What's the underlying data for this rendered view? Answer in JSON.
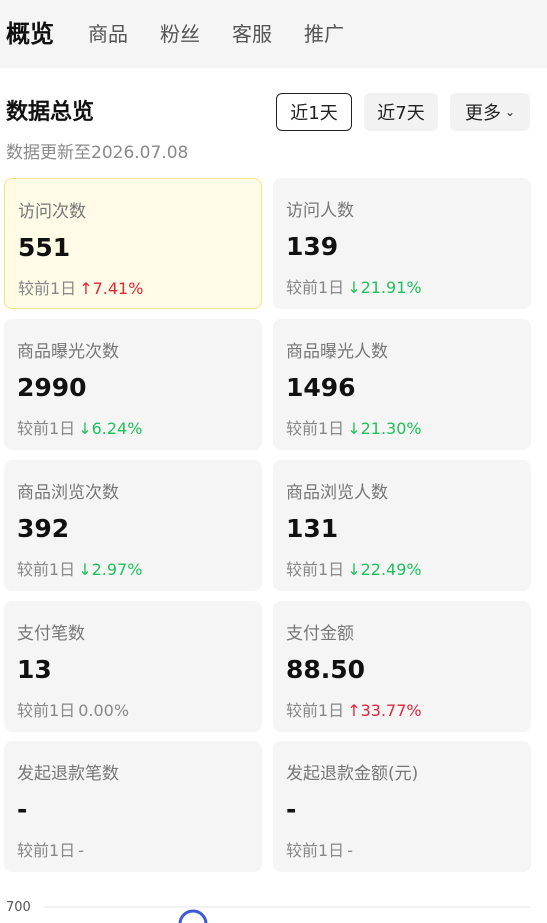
{
  "tabs": [
    "概览",
    "商品",
    "粉丝",
    "客服",
    "推广"
  ],
  "overview": {
    "title": "数据总览",
    "update_text": "数据更新至2026.07.08",
    "range_buttons": [
      "近1天",
      "近7天",
      "更多"
    ]
  },
  "compare_prefix": "较前1日",
  "metrics": [
    {
      "label": "访问次数",
      "value": "551",
      "change": "7.41%",
      "direction": "up",
      "arrow": "↑"
    },
    {
      "label": "访问人数",
      "value": "139",
      "change": "21.91%",
      "direction": "down",
      "arrow": "↓"
    },
    {
      "label": "商品曝光次数",
      "value": "2990",
      "change": "6.24%",
      "direction": "down",
      "arrow": "↓"
    },
    {
      "label": "商品曝光人数",
      "value": "1496",
      "change": "21.30%",
      "direction": "down",
      "arrow": "↓"
    },
    {
      "label": "商品浏览次数",
      "value": "392",
      "change": "2.97%",
      "direction": "down",
      "arrow": "↓"
    },
    {
      "label": "商品浏览人数",
      "value": "131",
      "change": "22.49%",
      "direction": "down",
      "arrow": "↓"
    },
    {
      "label": "支付笔数",
      "value": "13",
      "change": "0.00%",
      "direction": "flat",
      "arrow": ""
    },
    {
      "label": "支付金额",
      "value": "88.50",
      "change": "33.77%",
      "direction": "up",
      "arrow": "↑"
    },
    {
      "label": "发起退款笔数",
      "value": "-",
      "change": "-",
      "direction": "flat",
      "arrow": ""
    },
    {
      "label": "发起退款金额(元)",
      "value": "-",
      "change": "-",
      "direction": "flat",
      "arrow": ""
    }
  ],
  "chart": {
    "y_top_label": "700"
  },
  "colors": {
    "up": "#e0263b",
    "down": "#1ec25a",
    "highlight_bg": "#fffbe6",
    "highlight_border": "#f5e38a"
  }
}
